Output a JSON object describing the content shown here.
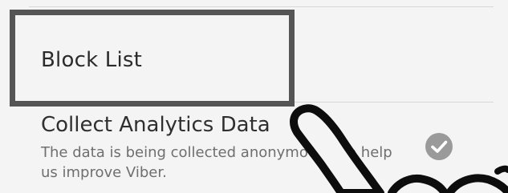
{
  "settings": {
    "block_list": {
      "label": "Block List"
    },
    "collect_analytics": {
      "title": "Collect Analytics Data",
      "description": "The data is being collected anonymously to help us improve Viber.",
      "checked": true
    }
  },
  "icons": {
    "checkbox": "check-circle-icon",
    "pointer": "hand-pointer-icon"
  },
  "colors": {
    "background": "#f4f4f4",
    "highlight": "#555555",
    "check_fill": "#9a9a9a"
  }
}
